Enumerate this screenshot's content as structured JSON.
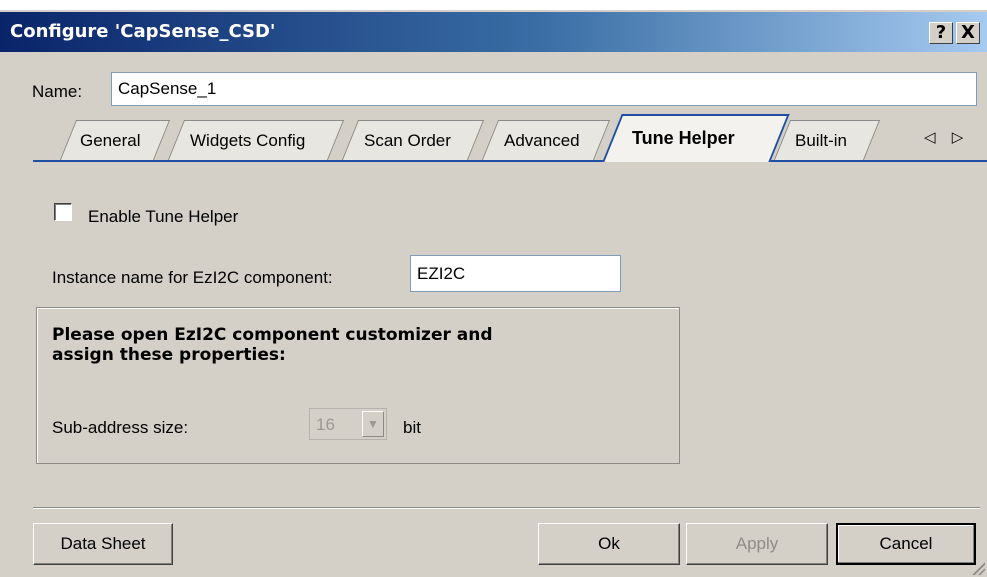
{
  "window": {
    "title": "Configure 'CapSense_CSD'",
    "help_label": "?",
    "close_label": "X"
  },
  "name_row": {
    "label": "Name:",
    "value": "CapSense_1"
  },
  "tabs": [
    {
      "label": "General",
      "active": false
    },
    {
      "label": "Widgets Config",
      "active": false
    },
    {
      "label": "Scan Order",
      "active": false
    },
    {
      "label": "Advanced",
      "active": false
    },
    {
      "label": "Tune Helper",
      "active": true
    },
    {
      "label": "Built-in",
      "active": false
    }
  ],
  "tab_scroll": "◁ ▷",
  "tune_helper": {
    "enable_label": "Enable Tune Helper",
    "enable_checked": false,
    "instance_label": "Instance name for EzI2C component:",
    "instance_value": "EZI2C",
    "group_text_line1": "Please open EzI2C component customizer and",
    "group_text_line2": "assign these properties:",
    "subaddress_label": "Sub-address size:",
    "subaddress_value": "16",
    "subaddress_unit": "bit"
  },
  "buttons": {
    "datasheet": "Data Sheet",
    "ok": "Ok",
    "apply": "Apply",
    "cancel": "Cancel"
  },
  "colors": {
    "titlebar_start": "#0a246a",
    "titlebar_end": "#a6caf0",
    "dialog_bg": "#d4d0c8",
    "tab_accent": "#1f4fa0"
  }
}
